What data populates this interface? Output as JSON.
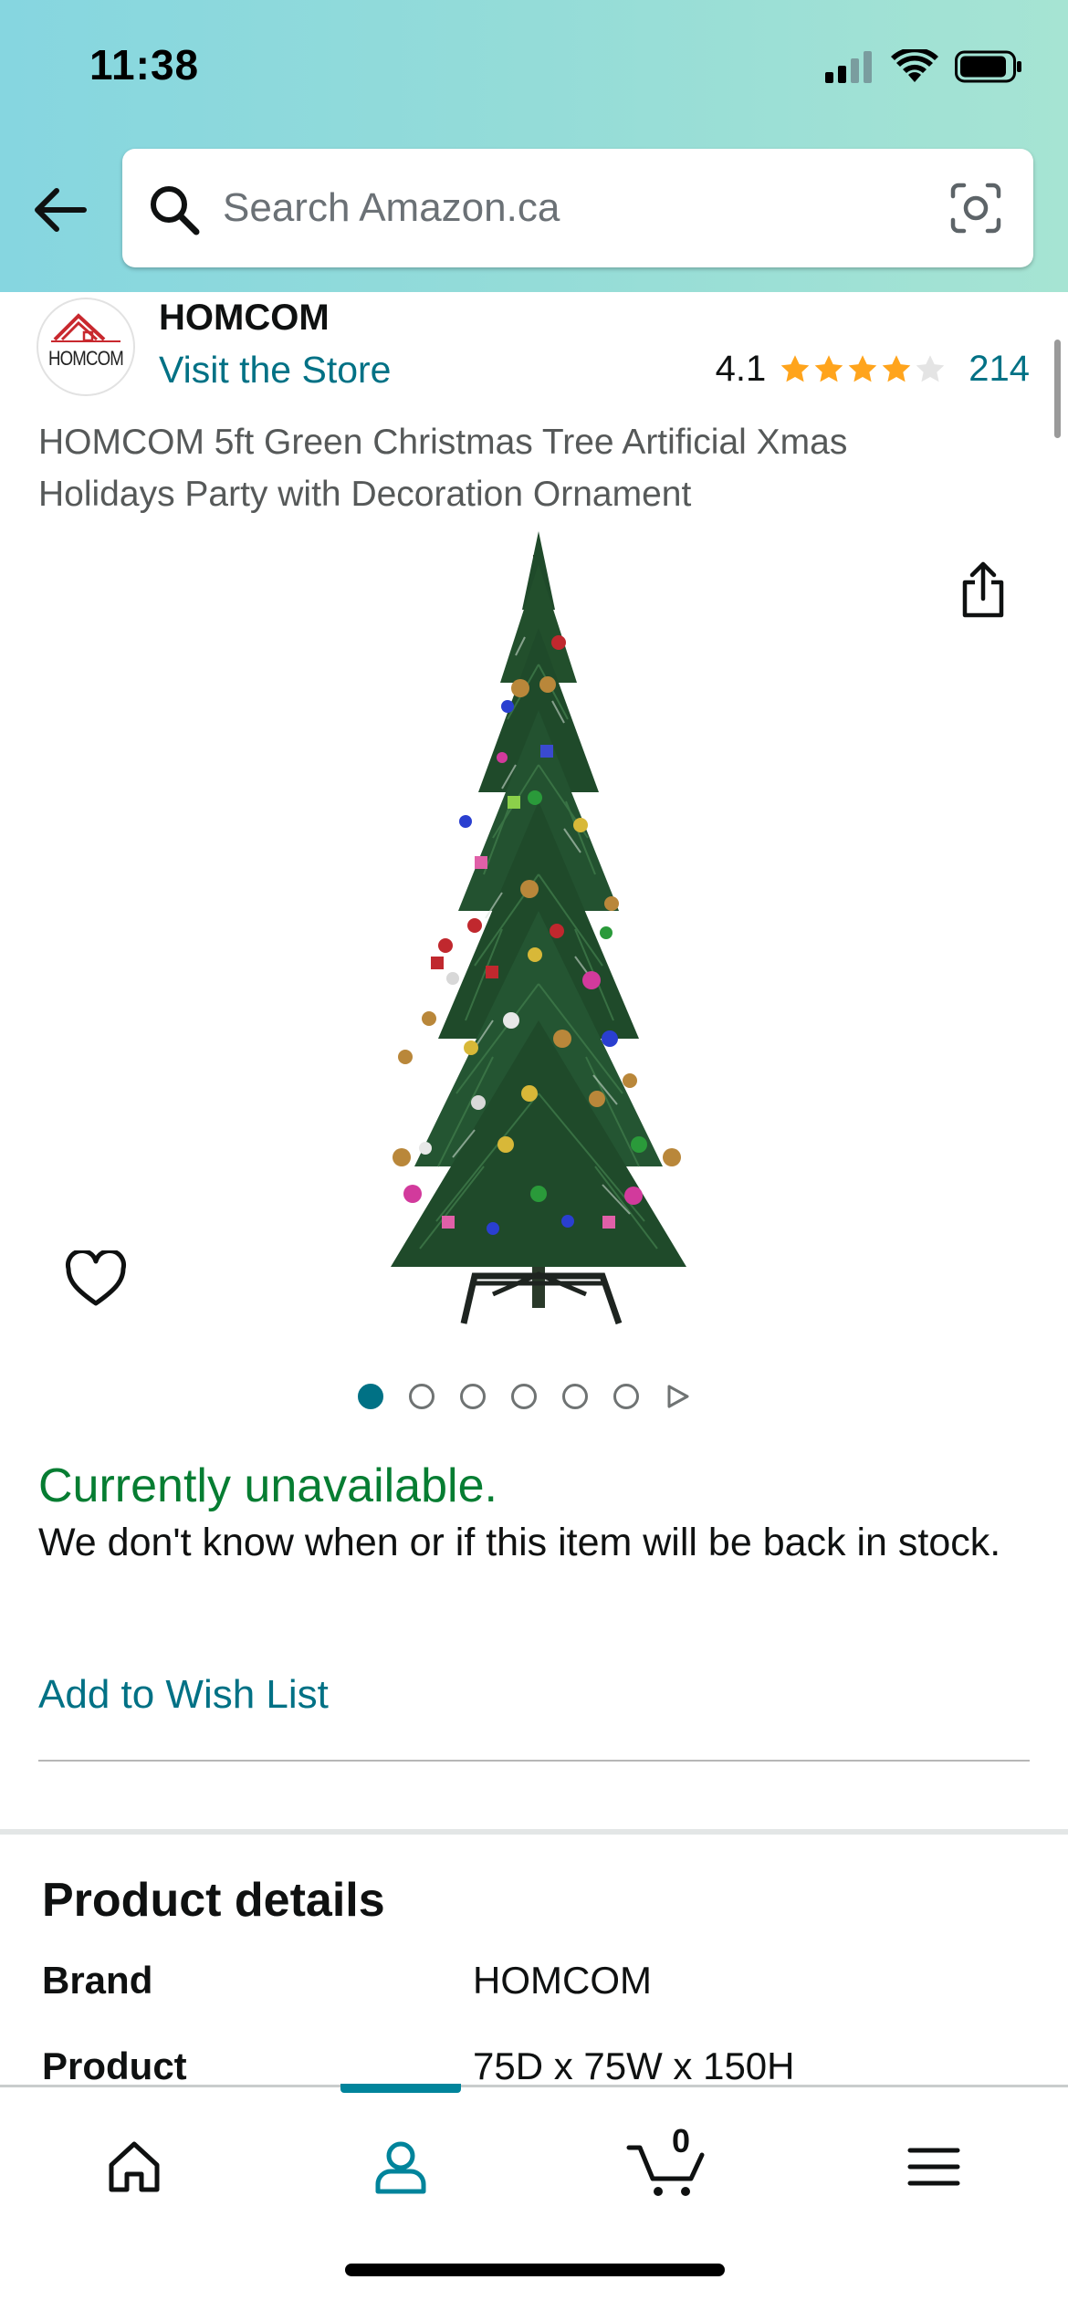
{
  "status_bar": {
    "time": "11:38"
  },
  "search": {
    "placeholder": "Search Amazon.ca"
  },
  "brand": {
    "logo_text": "HOMCOM",
    "name": "HOMCOM",
    "visit_store": "Visit the Store",
    "rating": "4.1",
    "stars": 4.1,
    "review_count": "214"
  },
  "product": {
    "title": "HOMCOM 5ft Green Christmas Tree Artificial Xmas Holidays Party with Decoration Ornament"
  },
  "carousel": {
    "dot_count": 6,
    "active_index": 0
  },
  "availability": {
    "status": "Currently unavailable.",
    "message": "We don't know when or if this item will be back in stock.",
    "wish_list_link": "Add to Wish List"
  },
  "details": {
    "title": "Product details",
    "rows": [
      {
        "label": "Brand",
        "value": "HOMCOM"
      },
      {
        "label": "Product",
        "value": "75D x 75W x 150H"
      }
    ]
  },
  "bottom_nav": {
    "items": [
      {
        "name": "home",
        "icon": "home-icon"
      },
      {
        "name": "account",
        "icon": "person-icon",
        "active": true
      },
      {
        "name": "cart",
        "icon": "cart-icon"
      },
      {
        "name": "menu",
        "icon": "hamburger-menu-icon"
      }
    ],
    "cart_count": "0"
  },
  "colors": {
    "link": "#007185",
    "available_green": "#067d32",
    "star": "#ffa41c",
    "active_nav": "#00849b"
  }
}
